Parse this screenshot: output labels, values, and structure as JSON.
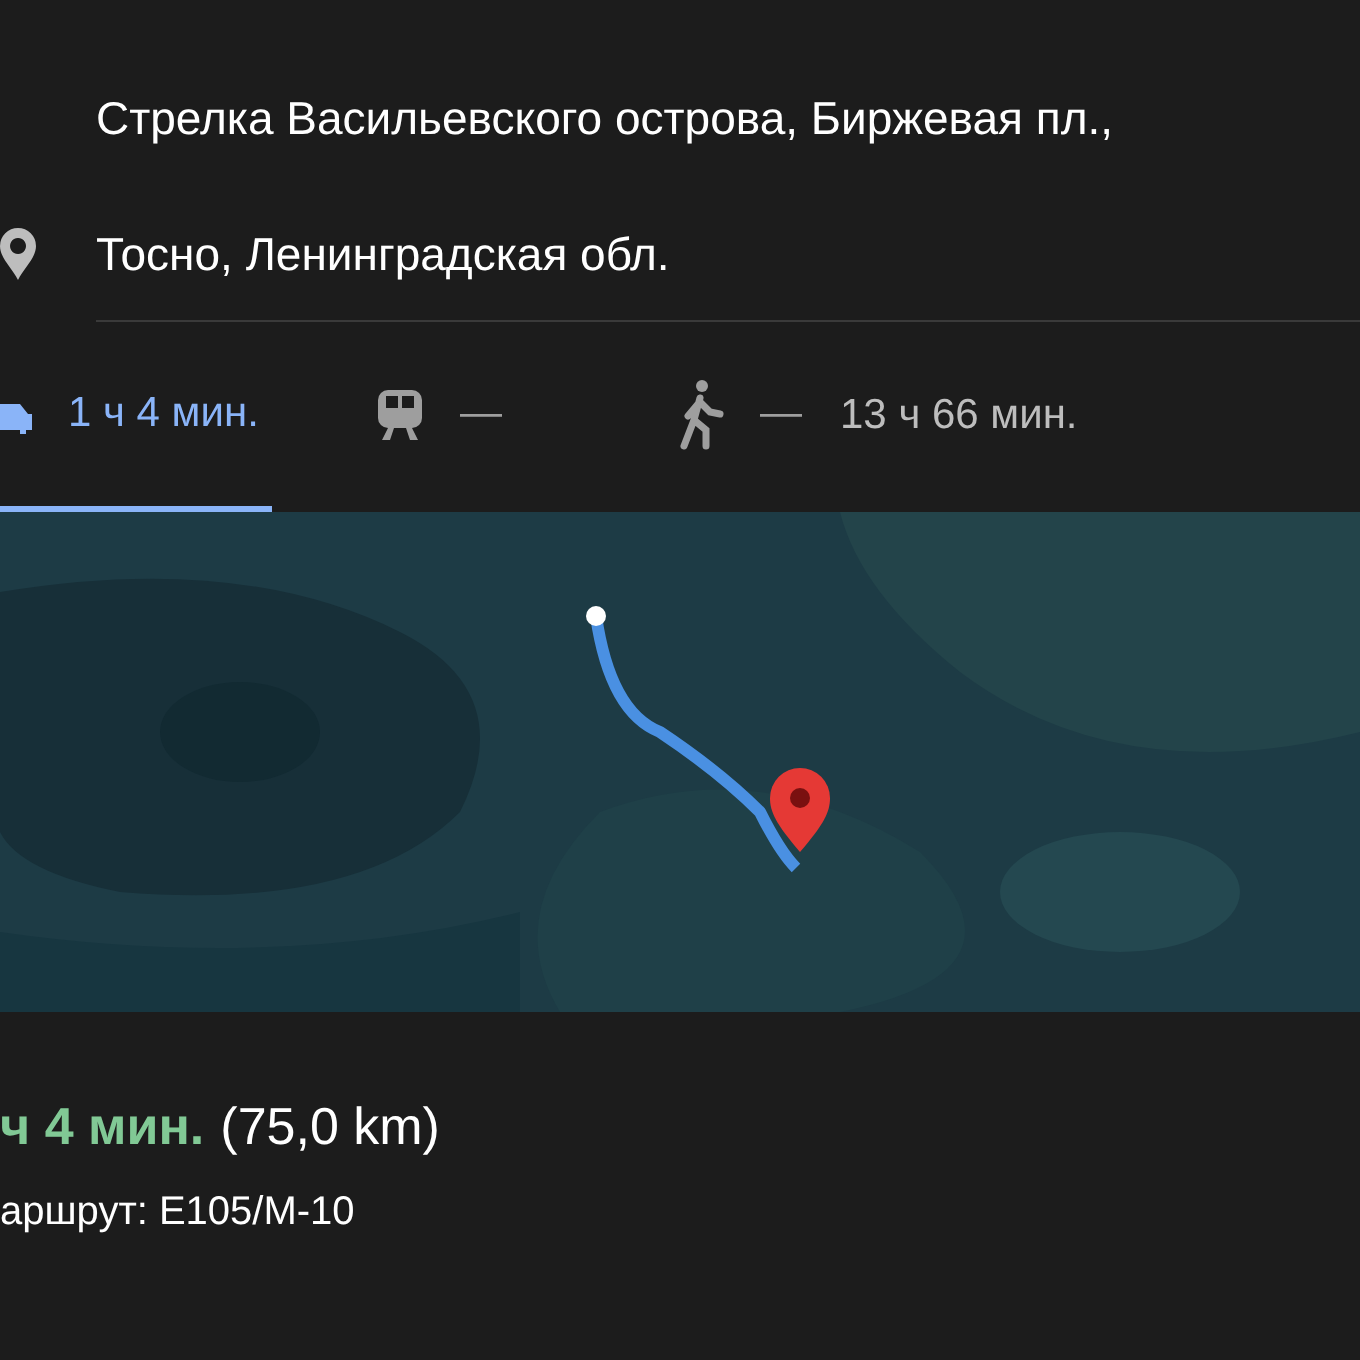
{
  "origin": {
    "value": "Стрелка Васильевского острова, Биржевая пл.,"
  },
  "destination": {
    "value": "Тосно, Ленинградская обл."
  },
  "modes": [
    {
      "kind": "car",
      "label": "1 ч 4 мин.",
      "selected": true
    },
    {
      "kind": "transit",
      "label": "—",
      "selected": false
    },
    {
      "kind": "walk",
      "label": "—",
      "selected": false
    },
    {
      "kind": "text",
      "label": "13 ч 66 мин.",
      "selected": false
    }
  ],
  "summary": {
    "duration": "ч 4 мин.",
    "distance": "(75,0 km)",
    "route": "аршрут: E105/M-10"
  }
}
